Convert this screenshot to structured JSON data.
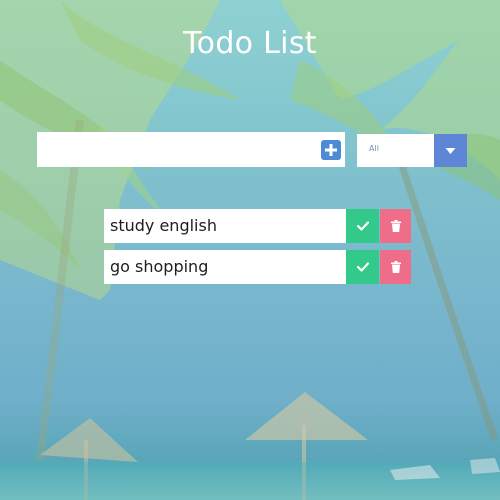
{
  "app": {
    "title": "Todo List"
  },
  "add_form": {
    "input_value": "",
    "input_placeholder": "",
    "add_icon": "plus-square-icon"
  },
  "filter": {
    "selected": "All",
    "arrow_icon": "caret-down-icon"
  },
  "todos": [
    {
      "text": "study english",
      "complete_icon": "check-icon",
      "delete_icon": "trash-icon"
    },
    {
      "text": "go shopping",
      "complete_icon": "check-icon",
      "delete_icon": "trash-icon"
    }
  ],
  "colors": {
    "add_button": "#4e8bd7",
    "filter_arrow": "#5f86d6",
    "complete_button": "#33c98a",
    "delete_button": "#ee6e8a"
  }
}
